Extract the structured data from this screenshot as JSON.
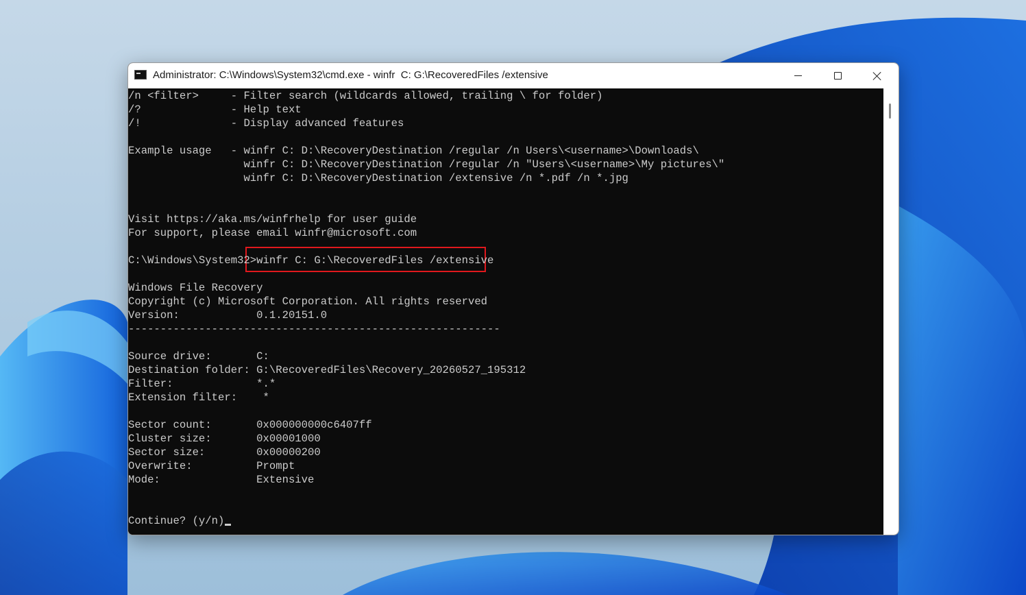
{
  "window": {
    "title": "Administrator: C:\\Windows\\System32\\cmd.exe - winfr  C: G:\\RecoveredFiles /extensive",
    "icon": "cmd-icon"
  },
  "controls": {
    "minimize": "minimize-icon",
    "maximize": "maximize-icon",
    "close": "close-icon"
  },
  "console": {
    "lines": [
      "/n <filter>     - Filter search (wildcards allowed, trailing \\ for folder)",
      "/?              - Help text",
      "/!              - Display advanced features",
      "",
      "Example usage   - winfr C: D:\\RecoveryDestination /regular /n Users\\<username>\\Downloads\\",
      "                  winfr C: D:\\RecoveryDestination /regular /n \"Users\\<username>\\My pictures\\\"",
      "                  winfr C: D:\\RecoveryDestination /extensive /n *.pdf /n *.jpg",
      "",
      "",
      "Visit https://aka.ms/winfrhelp for user guide",
      "For support, please email winfr@microsoft.com",
      "",
      "C:\\Windows\\System32>winfr C: G:\\RecoveredFiles /extensive",
      "",
      "Windows File Recovery",
      "Copyright (c) Microsoft Corporation. All rights reserved",
      "Version:            0.1.20151.0",
      "----------------------------------------------------------",
      "",
      "Source drive:       C:",
      "Destination folder: G:\\RecoveredFiles\\Recovery_20260527_195312",
      "Filter:             *.*",
      "Extension filter:    *",
      "",
      "Sector count:       0x000000000c6407ff",
      "Cluster size:       0x00001000",
      "Sector size:        0x00000200",
      "Overwrite:          Prompt",
      "Mode:               Extensive",
      "",
      "",
      "Continue? (y/n)"
    ]
  },
  "colors": {
    "console_bg": "#0c0c0c",
    "console_text": "#cccccc",
    "highlight": "#e0181d",
    "titlebar_bg": "#ffffff"
  }
}
